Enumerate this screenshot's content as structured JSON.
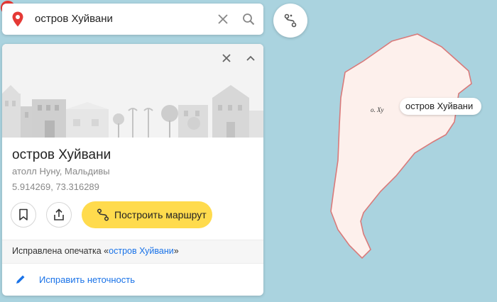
{
  "search": {
    "query": "остров Хуйвани",
    "icons": {
      "location": "location-pin-icon",
      "clear": "close-icon",
      "search": "search-icon"
    }
  },
  "route_fab": {
    "icon": "route-icon"
  },
  "place_card": {
    "title": "остров Хуйвани",
    "subtitle": "атолл Нуну, Мальдивы",
    "coordinates": "5.914269, 73.316289",
    "actions": {
      "route_label": "Построить маршрут",
      "icons": {
        "bookmark": "bookmark-icon",
        "share": "share-icon",
        "route": "route-icon"
      }
    },
    "notice": {
      "prefix": "Исправлена опечатка «",
      "link_text": "остров Хуйвани",
      "suffix": "»"
    },
    "fix_label": "Исправить неточность",
    "header_icons": {
      "close": "close-icon",
      "collapse": "chevron-up-icon"
    }
  },
  "map": {
    "island_label": "о. Ху",
    "pin_label": "остров Хуйвани",
    "colors": {
      "water": "#aad3df",
      "land": "#fdf0ec",
      "border": "#d97a7a",
      "pin": "#e53935"
    }
  }
}
